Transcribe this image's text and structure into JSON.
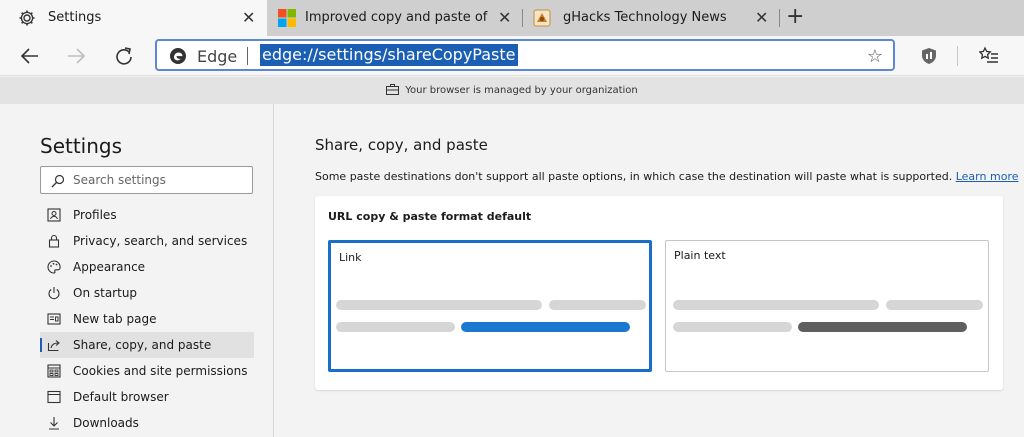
{
  "tabs": [
    {
      "title": "Settings",
      "icon": "gear-icon",
      "active": true
    },
    {
      "title": "Improved copy and paste of URL",
      "icon": "microsoft-logo-icon",
      "active": false
    },
    {
      "title": "gHacks Technology News",
      "icon": "ghacks-logo-icon",
      "active": false
    }
  ],
  "address_bar": {
    "browser_label": "Edge",
    "url": "edge://settings/shareCopyPaste"
  },
  "managed_banner": "Your browser is managed by your organization",
  "sidebar": {
    "title": "Settings",
    "search_placeholder": "Search settings",
    "items": [
      {
        "label": "Profiles",
        "icon": "profile-icon"
      },
      {
        "label": "Privacy, search, and services",
        "icon": "lock-icon"
      },
      {
        "label": "Appearance",
        "icon": "palette-icon"
      },
      {
        "label": "On startup",
        "icon": "power-icon"
      },
      {
        "label": "New tab page",
        "icon": "new-tab-icon"
      },
      {
        "label": "Share, copy, and paste",
        "icon": "share-icon",
        "selected": true
      },
      {
        "label": "Cookies and site permissions",
        "icon": "site-permissions-icon"
      },
      {
        "label": "Default browser",
        "icon": "browser-icon"
      },
      {
        "label": "Downloads",
        "icon": "download-icon"
      }
    ]
  },
  "main": {
    "title": "Share, copy, and paste",
    "description": "Some paste destinations don't support all paste options, in which case the destination will paste what is supported.",
    "learn_more": "Learn more",
    "card": {
      "title": "URL copy & paste format default",
      "options": [
        {
          "label": "Link",
          "selected": true
        },
        {
          "label": "Plain text",
          "selected": false
        }
      ]
    }
  },
  "colors": {
    "accent": "#1a6ec8",
    "link_bar": "#1a78d0",
    "plain_bar": "#5f5f5f",
    "placeholder_bar": "#d6d6d6"
  }
}
